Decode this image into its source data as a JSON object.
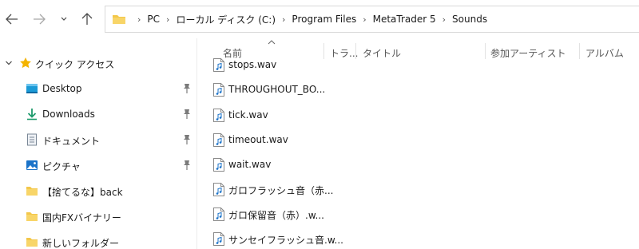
{
  "address_bar": {
    "crumbs": [
      "PC",
      "ローカル ディスク (C:)",
      "Program Files",
      "MetaTrader 5",
      "Sounds"
    ],
    "separator": "›"
  },
  "sidebar": {
    "quick_access_label": "クイック アクセス",
    "items": [
      {
        "label": "Desktop",
        "icon": "desktop-icon",
        "pinned": true
      },
      {
        "label": "Downloads",
        "icon": "download-icon",
        "pinned": true
      },
      {
        "label": "ドキュメント",
        "icon": "document-icon",
        "pinned": true
      },
      {
        "label": "ピクチャ",
        "icon": "pictures-icon",
        "pinned": true
      },
      {
        "label": "【捨てるな】back",
        "icon": "folder-icon",
        "pinned": false
      },
      {
        "label": "国内FXバイナリー",
        "icon": "folder-icon",
        "pinned": false
      },
      {
        "label": "新しいフォルダー",
        "icon": "folder-icon",
        "pinned": false
      }
    ]
  },
  "columns": {
    "name": "名前",
    "track": "トラ...",
    "title": "タイトル",
    "artist": "参加アーティスト",
    "album": "アルバム"
  },
  "files": [
    {
      "name": "stops.wav"
    },
    {
      "name": "THROUGHOUT_BO..."
    },
    {
      "name": "tick.wav"
    },
    {
      "name": "timeout.wav"
    },
    {
      "name": "wait.wav"
    },
    {
      "name": "ガロフラッシュ音（赤..."
    },
    {
      "name": "ガロ保留音（赤）.w..."
    },
    {
      "name": "サンセイフラッシュ音.w..."
    }
  ],
  "colors": {
    "folder": "#f3c74a",
    "accent": "#1b73c9",
    "star": "#f4b400"
  }
}
